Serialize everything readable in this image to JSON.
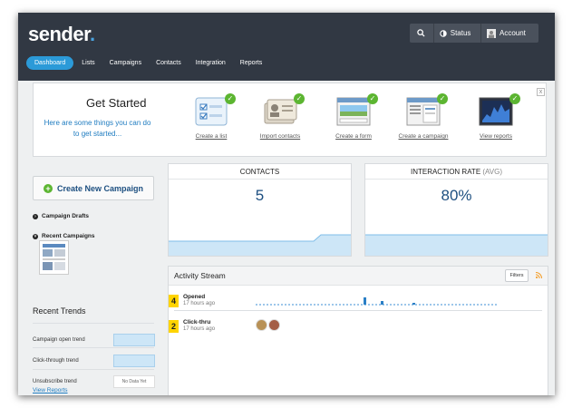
{
  "app": {
    "logo": "sender",
    "logo_dot": "."
  },
  "topbar": {
    "search_icon": "search-icon",
    "status_label": "Status",
    "account_label": "Account"
  },
  "nav": {
    "items": [
      "Dashboard",
      "Lists",
      "Campaigns",
      "Contacts",
      "Integration",
      "Reports"
    ],
    "active": "Dashboard"
  },
  "get_started": {
    "title": "Get Started",
    "subtitle": "Here are some things you can do to get started...",
    "steps": [
      {
        "label": "Create a list",
        "icon": "checklist-icon"
      },
      {
        "label": "Import contacts",
        "icon": "contact-cards-icon"
      },
      {
        "label": "Create a form",
        "icon": "form-window-icon"
      },
      {
        "label": "Create a campaign",
        "icon": "campaign-window-icon"
      },
      {
        "label": "View reports",
        "icon": "report-graph-icon"
      }
    ],
    "close_label": "x"
  },
  "sidebar": {
    "create_button": "Create New Campaign",
    "drafts_label": "Campaign Drafts",
    "recent_label": "Recent Campaigns",
    "trends_title": "Recent Trends",
    "trends": [
      {
        "label": "Campaign open trend",
        "status": "bar"
      },
      {
        "label": "Click-through trend",
        "status": "bar"
      },
      {
        "label": "Unsubscribe trend",
        "status": "No Data Yet"
      }
    ],
    "view_reports": "View Reports"
  },
  "stats": {
    "contacts_label": "CONTACTS",
    "contacts_value": "5",
    "interaction_label": "INTERACTION RATE",
    "interaction_sub": "(AVG)",
    "interaction_value": "80%"
  },
  "activity": {
    "title": "Activity Stream",
    "filters_label": "Filters",
    "items": [
      {
        "count": "4",
        "name": "Opened",
        "time": "17 hours ago"
      },
      {
        "count": "2",
        "name": "Click-thru",
        "time": "17 hours ago"
      }
    ]
  },
  "colors": {
    "header": "#313843",
    "accent": "#2b9ad8",
    "success": "#5cb531",
    "badge": "#ffd400",
    "chart_fill": "#cde6f7"
  }
}
